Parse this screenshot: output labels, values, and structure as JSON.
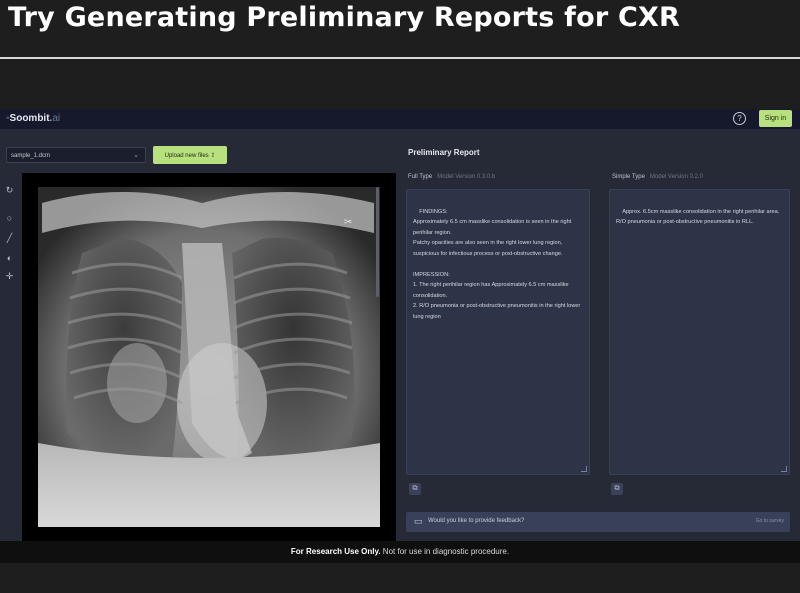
{
  "heading": "Try Generating Preliminary Reports for CXR",
  "app": {
    "logo": {
      "name": "Soombit",
      "suffix": "ai"
    },
    "signin_label": "Sign in",
    "file_select_value": "sample_1.dcm",
    "upload_label": "Upload new files",
    "report_title": "Preliminary Report",
    "full_type": {
      "label": "Full Type",
      "sub": "Model Version 0.3.0.b"
    },
    "simple_type": {
      "label": "Simple Type",
      "sub": "Model Version 0.2.0"
    },
    "full_report": "FINDINGS:\nApproximately 6.5 cm masslike consolidation is seen in the right perihilar region.\nPatchy opacities are also seen in the right lower lung region, suspicious for infectious process or post-obstructive change.\n\nIMPRESSION:\n1. The right perihilar region has Approximately 6.5 cm masslike consolidation.\n2. R/O pneumonia or post-obstructive pneumonitis in the right lower lung region",
    "simple_report": "Approx. 6.5cm masslike consolidation in the right perihilar area.\nR/O pneumonia or post-obstructive pneumonitis in RLL.",
    "feedback_text": "Would you like to provide feedback?",
    "feedback_link": "Go to survey"
  },
  "footer": {
    "bold": "For Research Use Only.",
    "rest": " Not for use in diagnostic procedure."
  },
  "icons": {
    "tools": [
      "rotate-icon",
      "zoom-icon",
      "ruler-icon",
      "contrast-icon",
      "pan-icon"
    ]
  },
  "colors": {
    "accent": "#b9e07e",
    "app_bg": "#262a36",
    "panel": "#2e3447"
  }
}
